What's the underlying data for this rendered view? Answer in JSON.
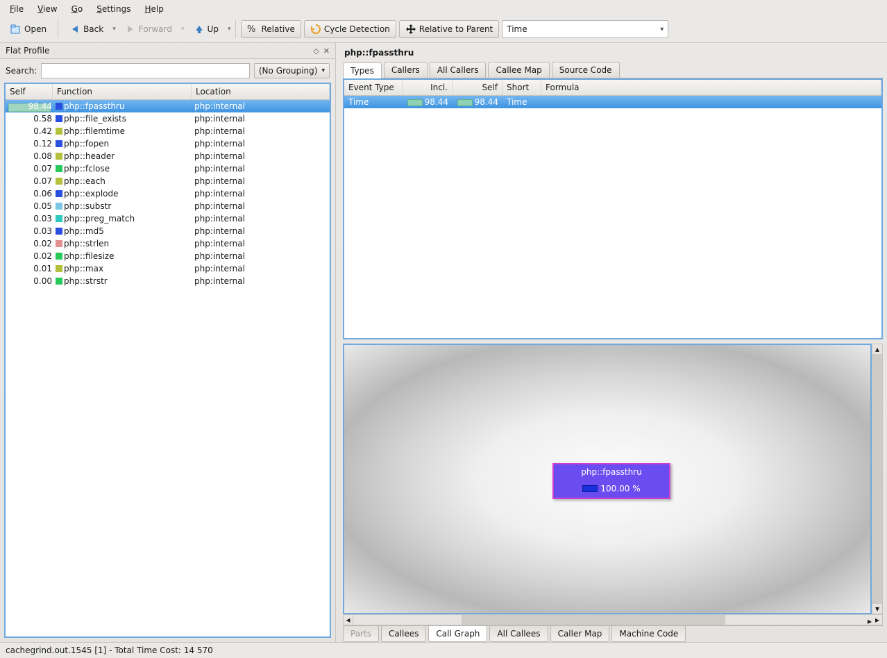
{
  "menubar": [
    "File",
    "View",
    "Go",
    "Settings",
    "Help"
  ],
  "toolbar": {
    "open": "Open",
    "back": "Back",
    "forward": "Forward",
    "up": "Up",
    "relative": "Relative",
    "cycle": "Cycle Detection",
    "rel_parent": "Relative to Parent",
    "combo": "Time"
  },
  "left": {
    "title": "Flat Profile",
    "search_label": "Search:",
    "grouping": "(No Grouping)",
    "columns": {
      "self": "Self",
      "func": "Function",
      "loc": "Location"
    },
    "rows": [
      {
        "self": "98.44",
        "func": "php::fpassthru",
        "loc": "php:internal",
        "color": "#2a4fe0",
        "selected": true,
        "bar": 98.44
      },
      {
        "self": "0.58",
        "func": "php::file_exists",
        "loc": "php:internal",
        "color": "#2a4fe0"
      },
      {
        "self": "0.42",
        "func": "php::filemtime",
        "loc": "php:internal",
        "color": "#b3c13c"
      },
      {
        "self": "0.12",
        "func": "php::fopen",
        "loc": "php:internal",
        "color": "#2a4fe0"
      },
      {
        "self": "0.08",
        "func": "php::header",
        "loc": "php:internal",
        "color": "#b3c13c"
      },
      {
        "self": "0.07",
        "func": "php::fclose",
        "loc": "php:internal",
        "color": "#27c95a"
      },
      {
        "self": "0.07",
        "func": "php::each",
        "loc": "php:internal",
        "color": "#b3c13c"
      },
      {
        "self": "0.06",
        "func": "php::explode",
        "loc": "php:internal",
        "color": "#2a4fe0"
      },
      {
        "self": "0.05",
        "func": "php::substr",
        "loc": "php:internal",
        "color": "#7dc6e6"
      },
      {
        "self": "0.03",
        "func": "php::preg_match",
        "loc": "php:internal",
        "color": "#2ec9c0"
      },
      {
        "self": "0.03",
        "func": "php::md5",
        "loc": "php:internal",
        "color": "#2a4fe0"
      },
      {
        "self": "0.02",
        "func": "php::strlen",
        "loc": "php:internal",
        "color": "#e38f8f"
      },
      {
        "self": "0.02",
        "func": "php::filesize",
        "loc": "php:internal",
        "color": "#27c95a"
      },
      {
        "self": "0.01",
        "func": "php::max",
        "loc": "php:internal",
        "color": "#b3c13c"
      },
      {
        "self": "0.00",
        "func": "php::strstr",
        "loc": "php:internal",
        "color": "#27c95a"
      }
    ]
  },
  "right": {
    "title": "php::fpassthru",
    "tabs_top": [
      "Types",
      "Callers",
      "All Callers",
      "Callee Map",
      "Source Code"
    ],
    "tabs_top_active": 0,
    "types_columns": {
      "et": "Event Type",
      "incl": "Incl.",
      "self": "Self",
      "short": "Short",
      "form": "Formula"
    },
    "types_row": {
      "et": "Time",
      "incl": "98.44",
      "self": "98.44",
      "short": "Time"
    },
    "node": {
      "label": "php::fpassthru",
      "percent": "100.00 %"
    },
    "tabs_bottom": [
      "Parts",
      "Callees",
      "Call Graph",
      "All Callees",
      "Caller Map",
      "Machine Code"
    ],
    "tabs_bottom_active": 2,
    "tabs_bottom_disabled": [
      0
    ]
  },
  "status": "cachegrind.out.1545 [1] - Total Time Cost: 14 570"
}
